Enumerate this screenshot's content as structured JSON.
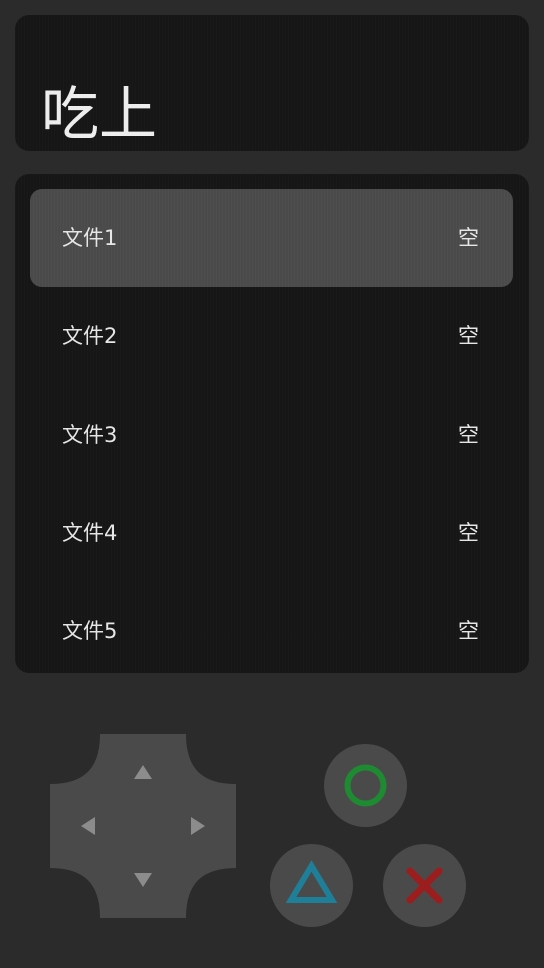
{
  "header": {
    "title": "吃上"
  },
  "save_slots": [
    {
      "name": "文件1",
      "status": "空",
      "selected": true
    },
    {
      "name": "文件2",
      "status": "空",
      "selected": false
    },
    {
      "name": "文件3",
      "status": "空",
      "selected": false
    },
    {
      "name": "文件4",
      "status": "空",
      "selected": false
    },
    {
      "name": "文件5",
      "status": "空",
      "selected": false
    }
  ],
  "controls": {
    "dpad": {
      "arrows": [
        "up",
        "down",
        "left",
        "right"
      ]
    },
    "buttons": [
      {
        "name": "circle",
        "icon": "circle-icon",
        "color": "#1e8a32"
      },
      {
        "name": "triangle",
        "icon": "triangle-icon",
        "color": "#1f7f99"
      },
      {
        "name": "cross",
        "icon": "cross-icon",
        "color": "#9b1d1d"
      }
    ]
  },
  "colors": {
    "background": "#2b2b2b",
    "panel": "#161616",
    "selected_row": "#4a4a4a",
    "text": "#e6e6e6"
  }
}
